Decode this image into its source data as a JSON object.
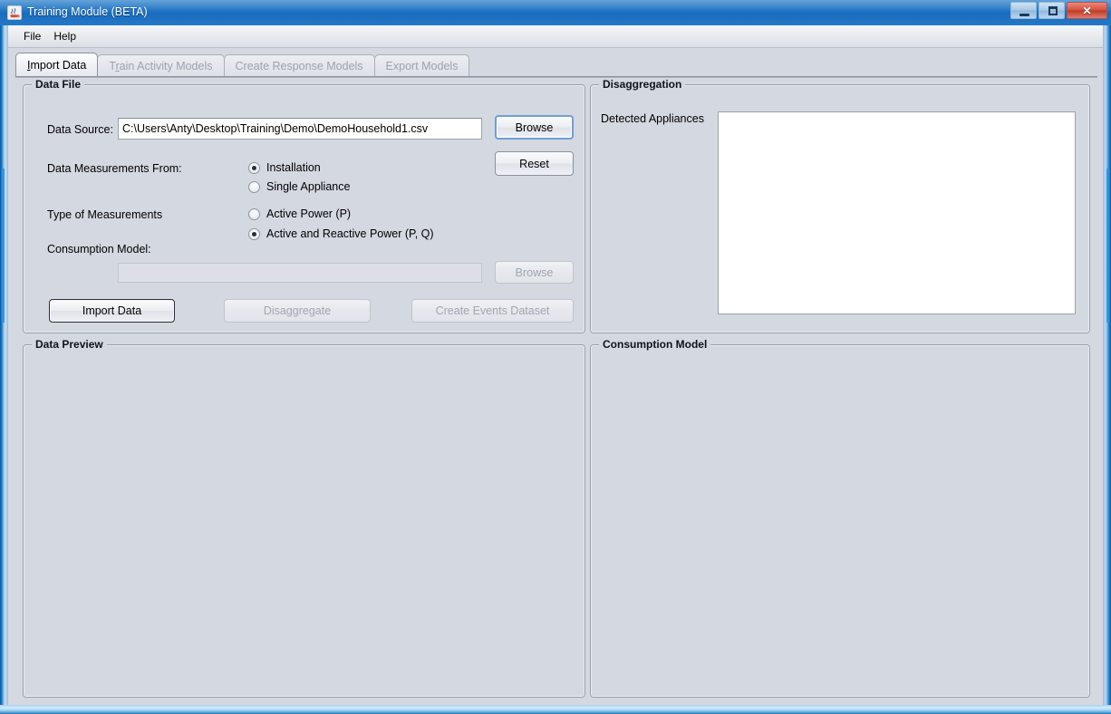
{
  "window": {
    "title": "Training Module (BETA)",
    "icon": "java-coffee-cup-icon",
    "minimize_label": "–",
    "maximize_label": "□",
    "close_label": "✕",
    "title_bar_color": "#1d72c4",
    "panel_color": "#d4d8e0"
  },
  "menu": {
    "items": [
      {
        "label": "File"
      },
      {
        "label": "Help"
      }
    ]
  },
  "tabs": [
    {
      "label": "Import Data",
      "mnemonic": "I",
      "rest": "mport Data",
      "active": true,
      "enabled": true
    },
    {
      "label": "Train Activity Models",
      "pre": "T",
      "mnemonic": "r",
      "rest": "ain Activity Models",
      "active": false,
      "enabled": false
    },
    {
      "label": "Create Response Models",
      "active": false,
      "enabled": false
    },
    {
      "label": "Export Models",
      "active": false,
      "enabled": false
    }
  ],
  "data_file_panel": {
    "title": "Data File",
    "data_source_label": "Data Source:",
    "data_source_value": "C:\\Users\\Anty\\Desktop\\Training\\Demo\\DemoHousehold1.csv",
    "browse_label": "Browse",
    "reset_label": "Reset",
    "measurements_from_label": "Data Measurements From:",
    "measurements_from_options": [
      {
        "label": "Installation",
        "selected": true
      },
      {
        "label": "Single Appliance",
        "selected": false
      }
    ],
    "type_of_measurements_label": "Type of Measurements",
    "type_of_measurements_options": [
      {
        "label": "Active Power (P)",
        "selected": false
      },
      {
        "label": "Active and Reactive Power (P, Q)",
        "selected": true
      }
    ],
    "consumption_model_label": "Consumption Model:",
    "consumption_model_value": "",
    "consumption_model_browse_label": "Browse",
    "import_data_label": "Import Data",
    "disaggregate_label": "Disaggregate",
    "create_events_dataset_label": "Create Events Dataset"
  },
  "disaggregation_panel": {
    "title": "Disaggregation",
    "detected_appliances_label": "Detected Appliances",
    "detected_appliances_items": []
  },
  "data_preview_panel": {
    "title": "Data Preview",
    "content": ""
  },
  "consumption_model_panel": {
    "title": "Consumption Model",
    "content": ""
  }
}
